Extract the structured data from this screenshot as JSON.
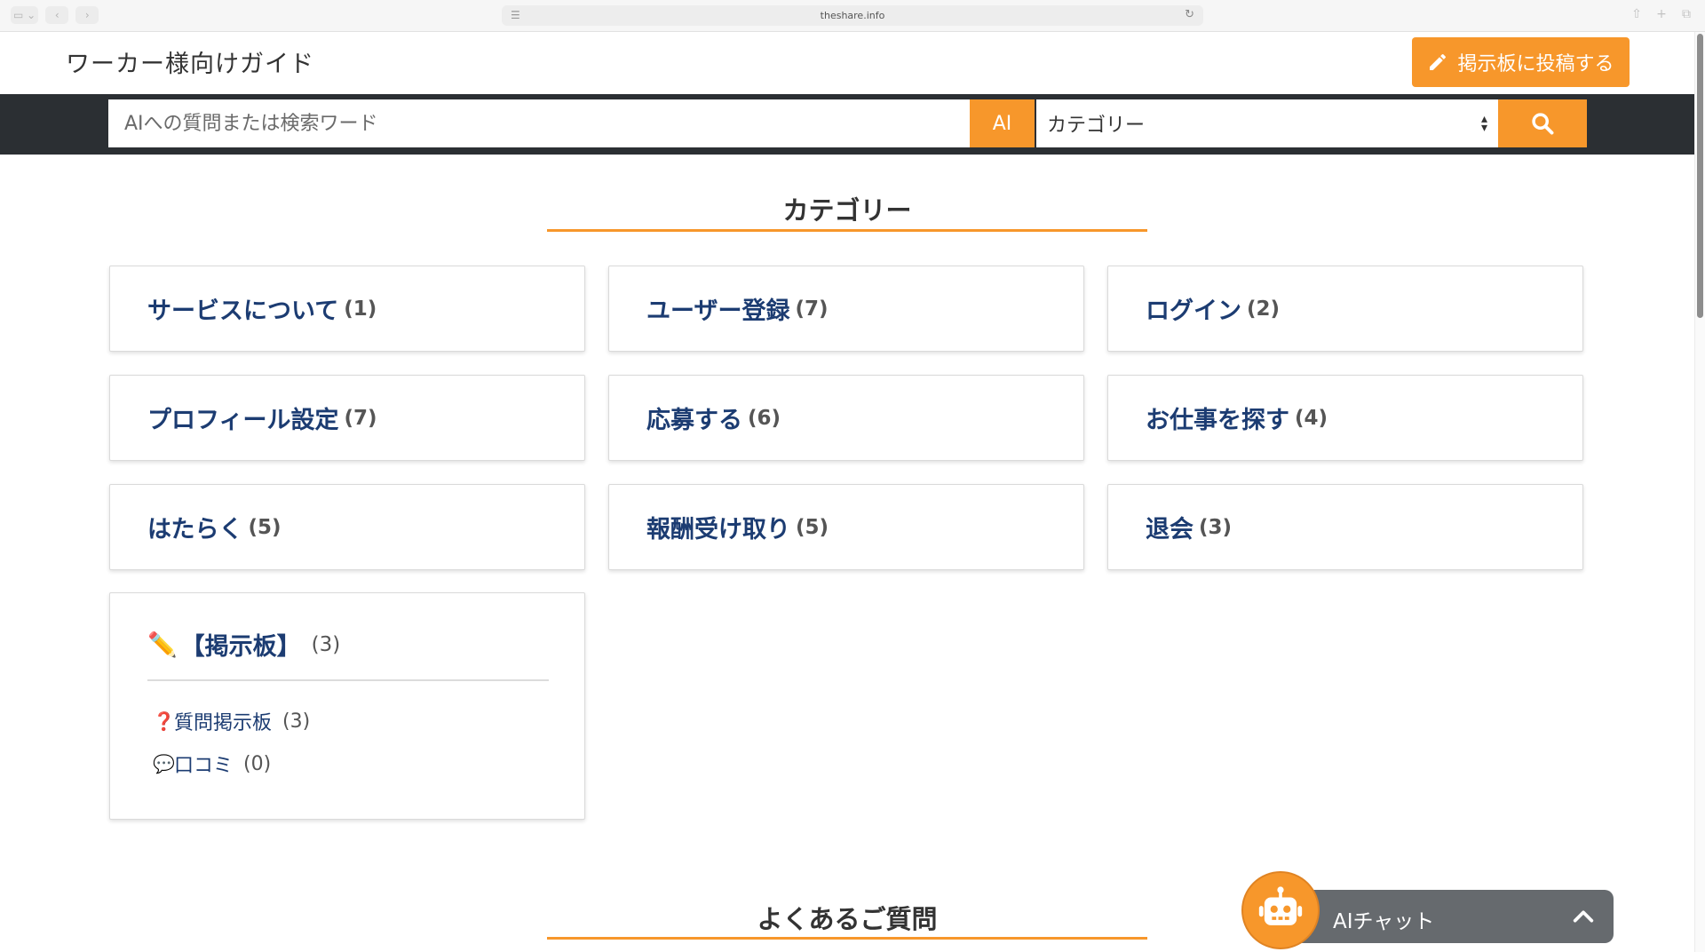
{
  "browser": {
    "url": "theshare.info"
  },
  "header": {
    "title": "ワーカー様向けガイド",
    "post_button": "掲示板に投稿する"
  },
  "search": {
    "placeholder": "AIへの質問または検索ワード",
    "ai_label": "AI",
    "category_selected": "カテゴリー"
  },
  "categories_section": {
    "heading": "カテゴリー",
    "items": [
      {
        "name": "サービスについて",
        "count": "(1)"
      },
      {
        "name": "ユーザー登録",
        "count": "(7)"
      },
      {
        "name": "ログイン",
        "count": "(2)"
      },
      {
        "name": "プロフィール設定",
        "count": "(7)"
      },
      {
        "name": "応募する",
        "count": "(6)"
      },
      {
        "name": "お仕事を探す",
        "count": "(4)"
      },
      {
        "name": "はたらく",
        "count": "(5)"
      },
      {
        "name": "報酬受け取り",
        "count": "(5)"
      },
      {
        "name": "退会",
        "count": "(3)"
      }
    ],
    "board": {
      "icon": "✏️",
      "name": "【掲示板】",
      "count": "(3)",
      "items": [
        {
          "icon": "❓",
          "label": "質問掲示板",
          "count": "(3)"
        },
        {
          "icon": "💬",
          "label": "口コミ",
          "count": "(0)"
        }
      ]
    }
  },
  "faq_section": {
    "heading": "よくあるご質問"
  },
  "ai_chat": {
    "label": "AIチャット"
  },
  "colors": {
    "accent": "#f7972b",
    "dark_bar": "#2b2f33",
    "link": "#1c3c72"
  }
}
